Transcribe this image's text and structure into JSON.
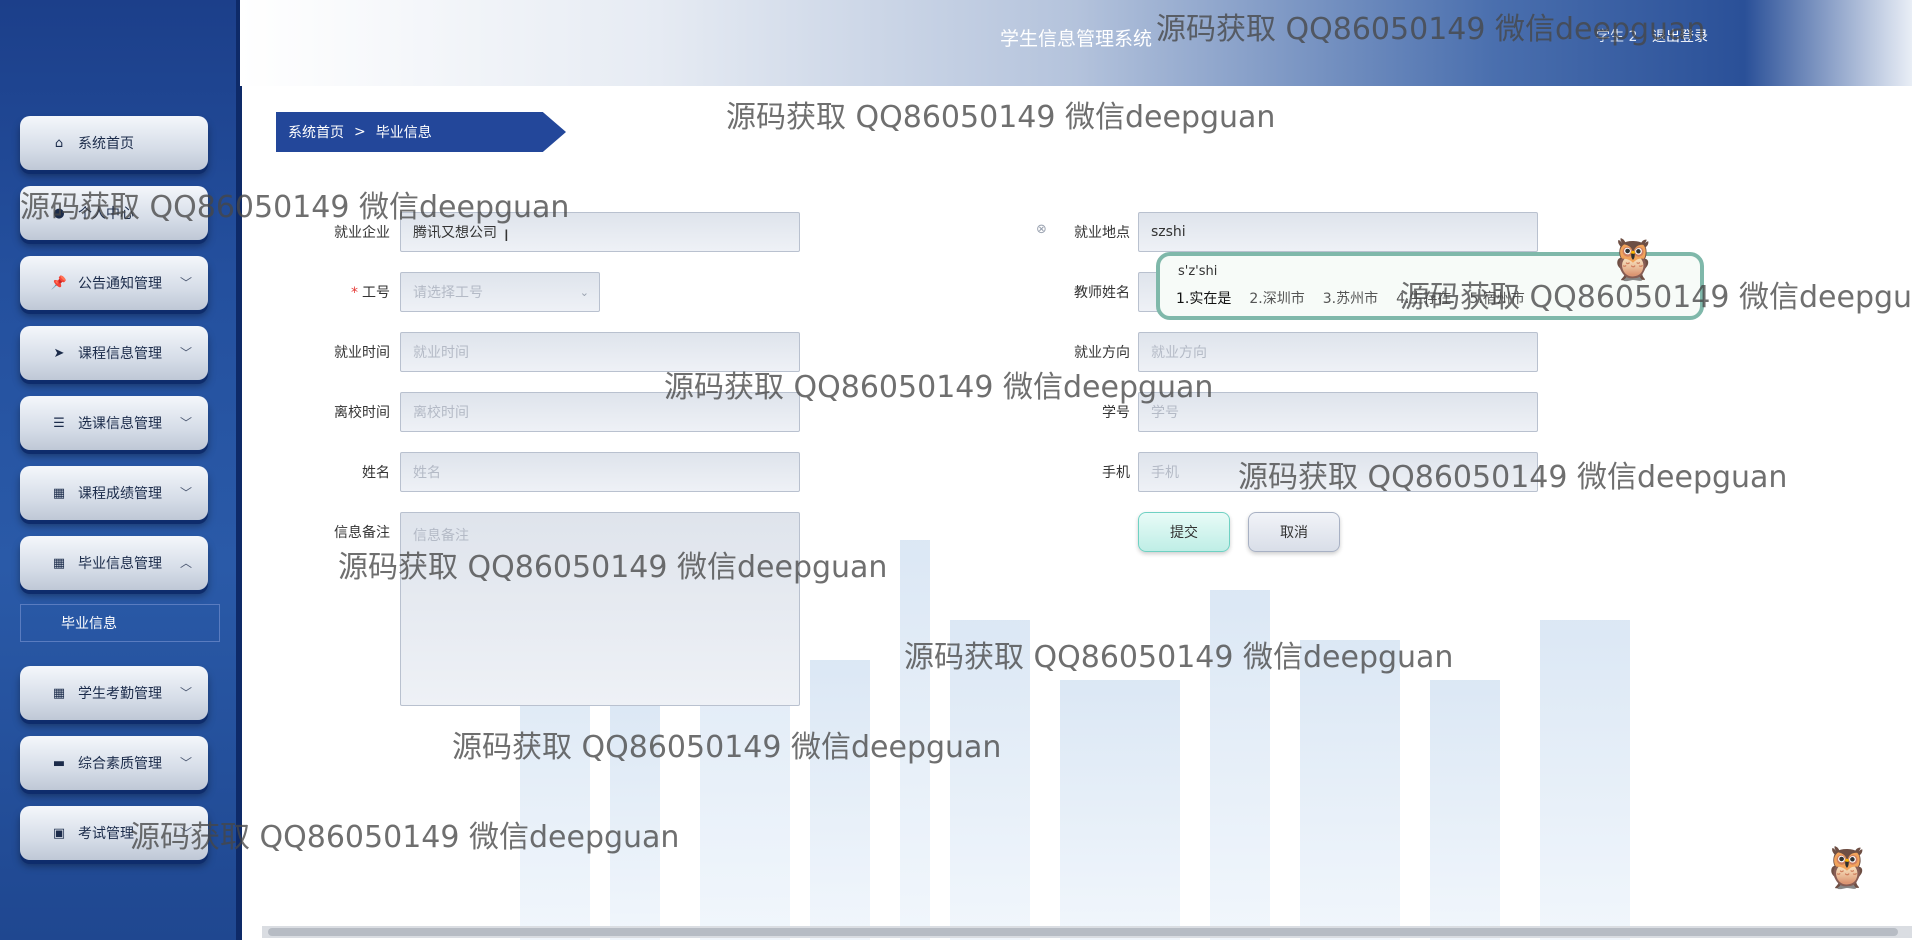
{
  "header": {
    "title": "学生信息管理系统",
    "user": "学生 2",
    "logout": "退出登录"
  },
  "sidebar": {
    "items": [
      {
        "label": "系统首页",
        "icon": "home-icon",
        "glyph": "⌂",
        "expandable": false
      },
      {
        "label": "个人中心",
        "icon": "user-icon",
        "glyph": "●",
        "expandable": false
      },
      {
        "label": "公告通知管理",
        "icon": "pin-icon",
        "glyph": "📌",
        "expandable": true
      },
      {
        "label": "课程信息管理",
        "icon": "send-icon",
        "glyph": "➤",
        "expandable": true
      },
      {
        "label": "选课信息管理",
        "icon": "sliders-icon",
        "glyph": "☰",
        "expandable": true
      },
      {
        "label": "课程成绩管理",
        "icon": "grid-icon",
        "glyph": "▦",
        "expandable": true
      },
      {
        "label": "毕业信息管理",
        "icon": "grid-icon",
        "glyph": "▦",
        "expandable": true,
        "expanded": true
      },
      {
        "label": "学生考勤管理",
        "icon": "grid-icon",
        "glyph": "▦",
        "expandable": true
      },
      {
        "label": "综合素质管理",
        "icon": "laptop-icon",
        "glyph": "▬",
        "expandable": true
      },
      {
        "label": "考试管理",
        "icon": "wallet-icon",
        "glyph": "▣",
        "expandable": true
      }
    ],
    "sub_item": "毕业信息"
  },
  "breadcrumb": {
    "home": "系统首页",
    "separator": ">",
    "current": "毕业信息"
  },
  "form": {
    "company": {
      "label": "就业企业",
      "value": "腾讯又想公司"
    },
    "location": {
      "label": "就业地点",
      "value": "szshi"
    },
    "job_no": {
      "label": "工号",
      "placeholder": "请选择工号"
    },
    "teacher_name": {
      "label": "教师姓名"
    },
    "employ_time": {
      "label": "就业时间",
      "placeholder": "就业时间"
    },
    "direction": {
      "label": "就业方向",
      "placeholder": "就业方向"
    },
    "leave_time": {
      "label": "离校时间",
      "placeholder": "离校时间"
    },
    "student_no": {
      "label": "学号",
      "placeholder": "学号"
    },
    "name": {
      "label": "姓名",
      "placeholder": "姓名"
    },
    "phone": {
      "label": "手机",
      "placeholder": "手机"
    },
    "remark": {
      "label": "信息备注",
      "placeholder": "信息备注"
    },
    "submit": "提交",
    "cancel": "取消"
  },
  "ime": {
    "composition": "s'z'shi",
    "candidates": [
      "1.实在是",
      "2.深圳市",
      "3.苏州市",
      "4.生存在",
      "5.宿州市"
    ]
  },
  "watermark": "源码获取 QQ86050149 微信deepguan",
  "colors": {
    "sidebar": "#24509e",
    "breadcrumb": "#23479a",
    "submit_border": "#6fd1c3",
    "required": "#e53935"
  }
}
